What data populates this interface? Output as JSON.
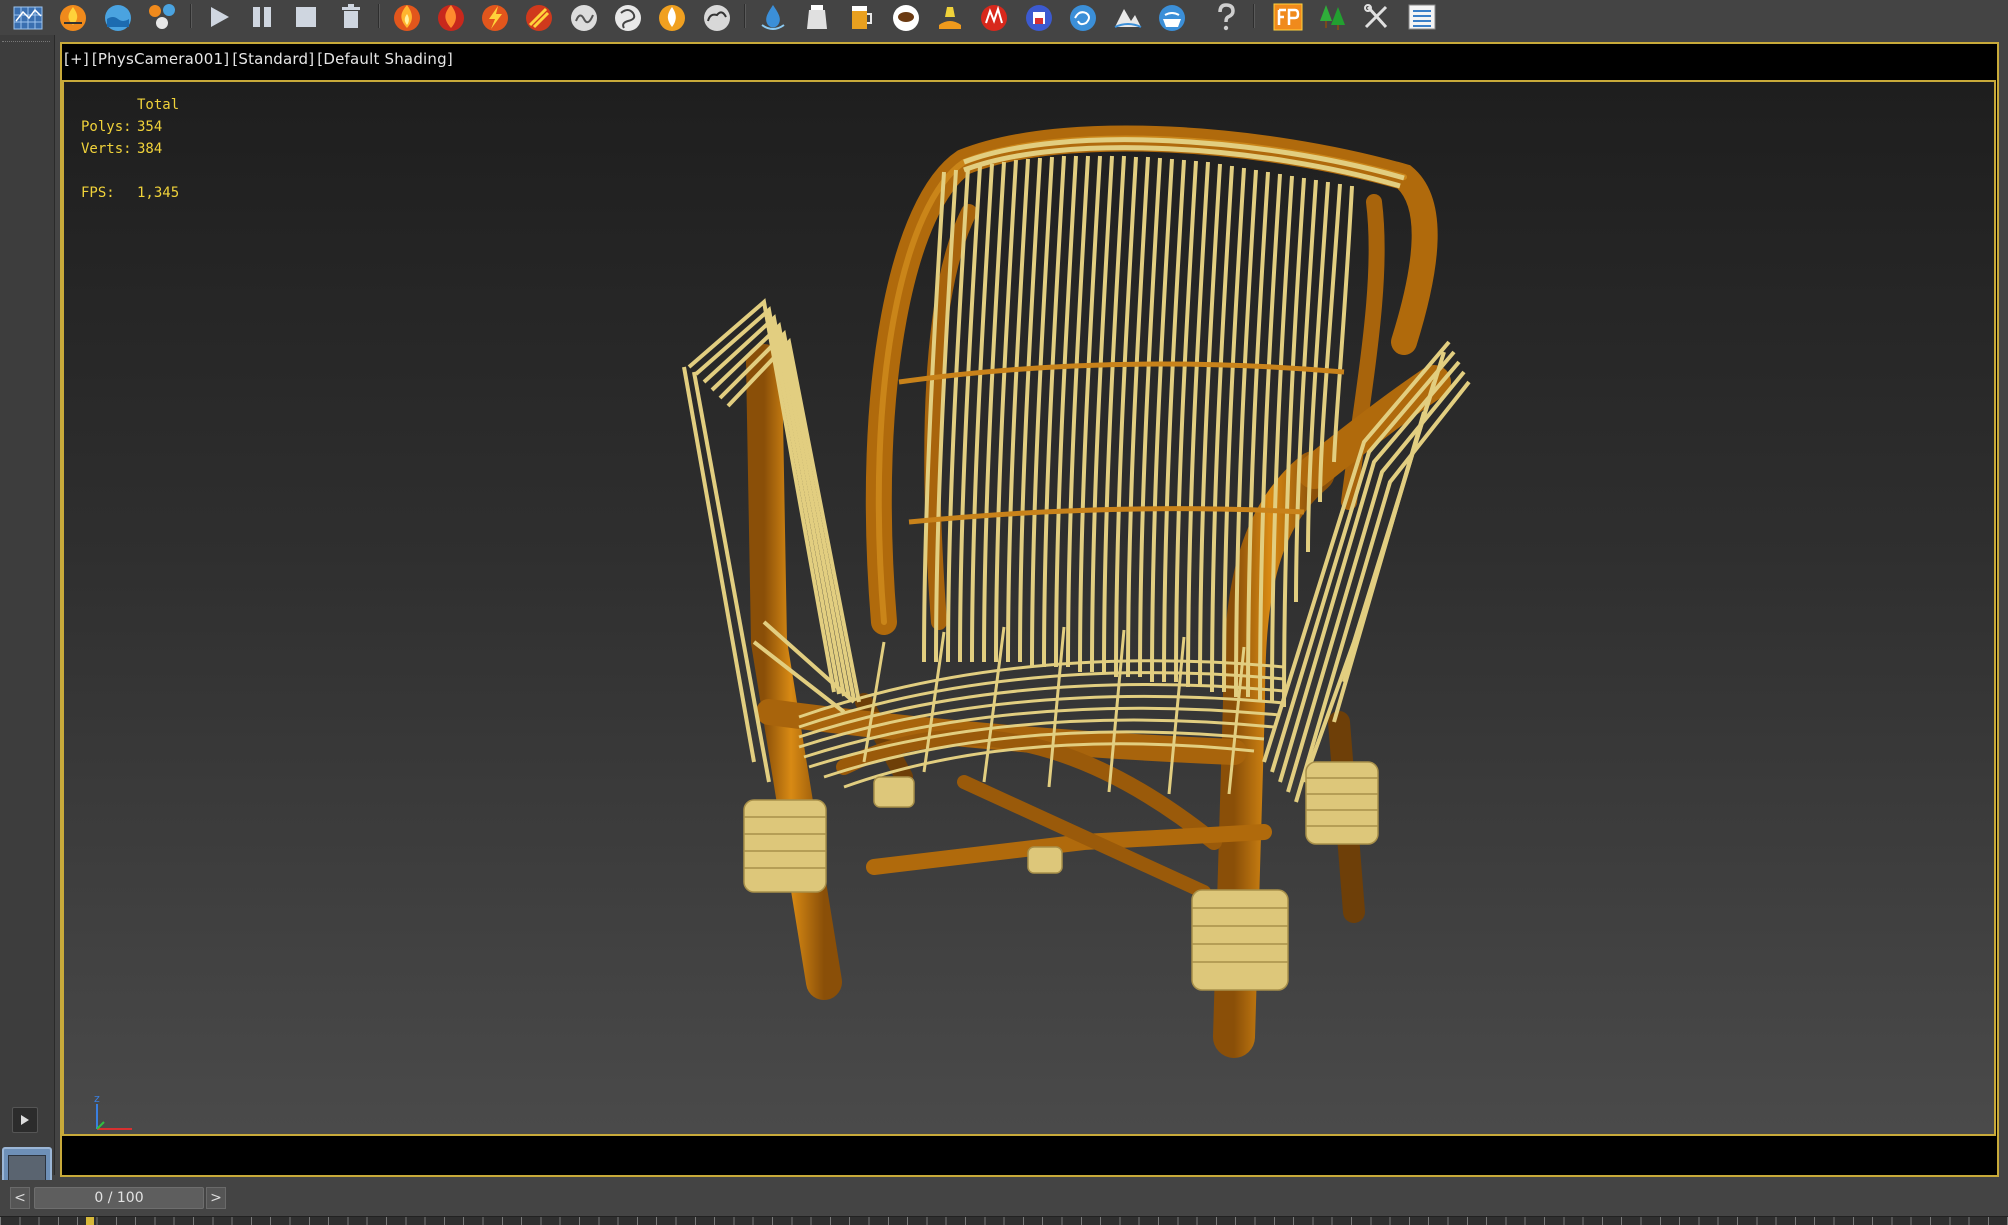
{
  "viewport": {
    "label_plus": "[+]",
    "label_camera": "[PhysCamera001]",
    "label_renderer": "[Standard]",
    "label_shading": "[Default Shading]",
    "stats": {
      "header": "Total",
      "polys_label": "Polys:",
      "polys_value": "354",
      "verts_label": "Verts:",
      "verts_value": "384",
      "fps_label": "FPS:",
      "fps_value": "1,345"
    },
    "axis": {
      "z_label": "z"
    },
    "colors": {
      "frame": "#c8aa3a",
      "stats_text": "#f0d23a",
      "chair_frame": "#c27a10",
      "rattan": "#e0cc7e"
    }
  },
  "timeline": {
    "prev_label": "<",
    "next_label": ">",
    "frame_readout": "0 / 100",
    "current_frame": 0,
    "total_frames": 100
  },
  "toolbar": {
    "icons": [
      "grid-icon",
      "fire-bowl-icon",
      "water-bowl-icon",
      "particles-icon",
      "play-icon",
      "pause-icon",
      "stop-icon",
      "trash-icon",
      "fire-icon",
      "fire-red-icon",
      "fire-bolt-icon",
      "fire-spark-icon",
      "smoke-icon",
      "smoke-swirl-icon",
      "flame-icon",
      "smoke-cloud-icon",
      "water-drop-icon",
      "container-icon",
      "beer-mug-icon",
      "coffee-cup-icon",
      "lava-pour-icon",
      "splash-icon",
      "floppy-disk-icon",
      "water-swirl-icon",
      "wave-mountain-icon",
      "water-cup-icon",
      "help-icon",
      "fp-logo-icon",
      "trees-icon",
      "tools-icon",
      "list-icon"
    ]
  }
}
